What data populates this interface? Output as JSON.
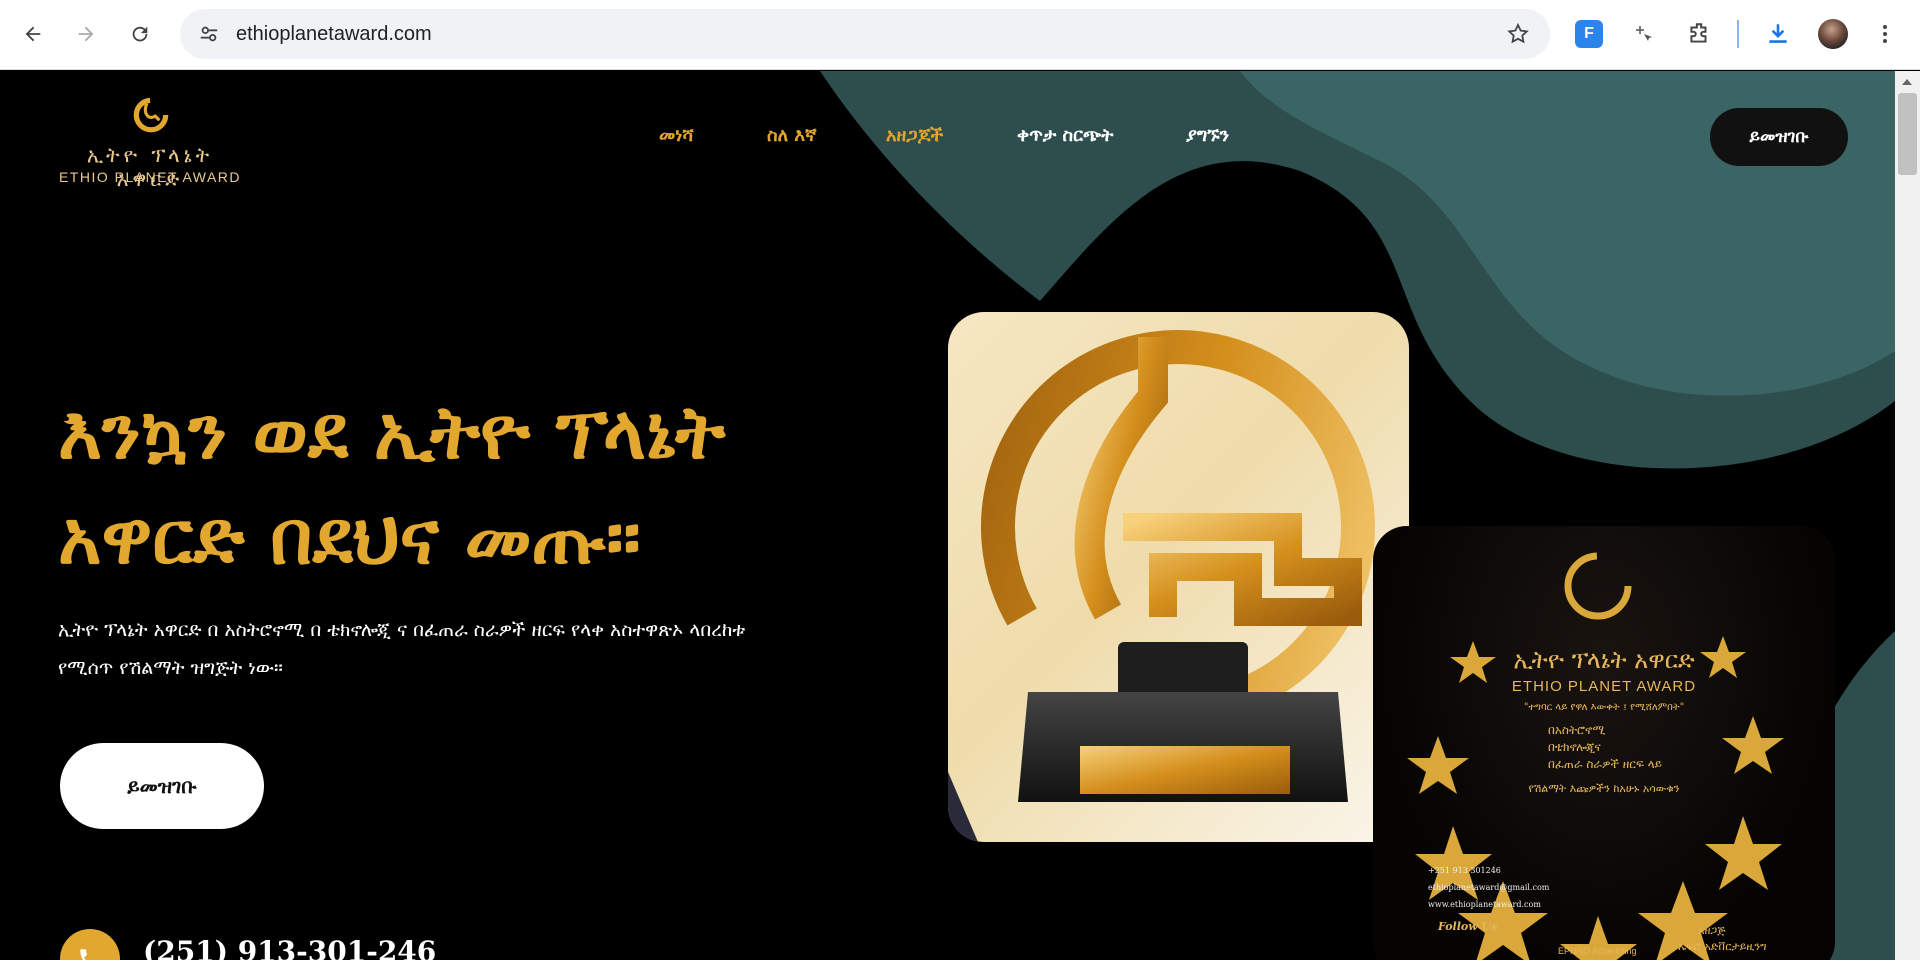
{
  "browser": {
    "url": "ethioplanetaward.com",
    "back_icon": "arrow-left-icon",
    "forward_icon": "arrow-right-icon",
    "reload_icon": "reload-icon",
    "site_info_icon": "tune-icon",
    "bookmark_icon": "star-icon"
  },
  "site": {
    "logo_amharic": "ኢትዮ ፕላኔት አዋርድ",
    "logo_english": "ETHIO PLANET AWARD",
    "nav": [
      {
        "label": "መነሻ",
        "active": true
      },
      {
        "label": "ስለ እኛ",
        "active": true
      },
      {
        "label": "አዘጋጆች",
        "active": true
      },
      {
        "label": "ቀጥታ ስርጭት",
        "active": false
      },
      {
        "label": "ያግኙን",
        "active": false
      }
    ],
    "register_top": "ይመዝገቡ",
    "hero_title_line1": "እንኳን ወደ ኢትዮ ፕላኔት",
    "hero_title_line2": "አዋርድ በደህና መጡ።",
    "hero_subtitle_line1": "ኢትዮ ፕላኔት አዋርድ በ አስትሮኖሚ በ ቴክኖሎጂ ና በፈጠራ ስራዎች ዘርፍ የላቀ አስተዋጽኦ ላበረከቱ",
    "hero_subtitle_line2": "የሚሰጥ የሽልማት ዝግጅት ነው።",
    "register_main": "ይመዝገቡ",
    "phone": "(251) 913-301-246"
  },
  "poster": {
    "title_amharic": "ኢትዮ ፕላኔት አዋርድ",
    "title_english": "ETHIO PLANET AWARD",
    "tagline": "\"ተግባር ላይ የዋለ እውቀት ፤ የሚሸለምበት\"",
    "items": [
      "በአስትሮኖሚ",
      "በቴክኖሎጂና",
      "በፈጠራ ስራዎች ዘርፍ ላይ"
    ],
    "line1": "የሽልማት እጩዎችን ከአሁኑ አሳውቁን",
    "phone": "+251 913 301246",
    "email": "ethioplanetaward@gmail.com",
    "web": "www.ethioplanetaward.com",
    "follow": "Follow Us",
    "agency": "EPHRO Advertising",
    "organizer_label": "አዘጋጅ",
    "organizer": "ኤፍሮ አድቨርታይዚንግ"
  },
  "colors": {
    "gold": "#e1a72e",
    "teal": "#2f5252",
    "page_bg": "#000000"
  }
}
